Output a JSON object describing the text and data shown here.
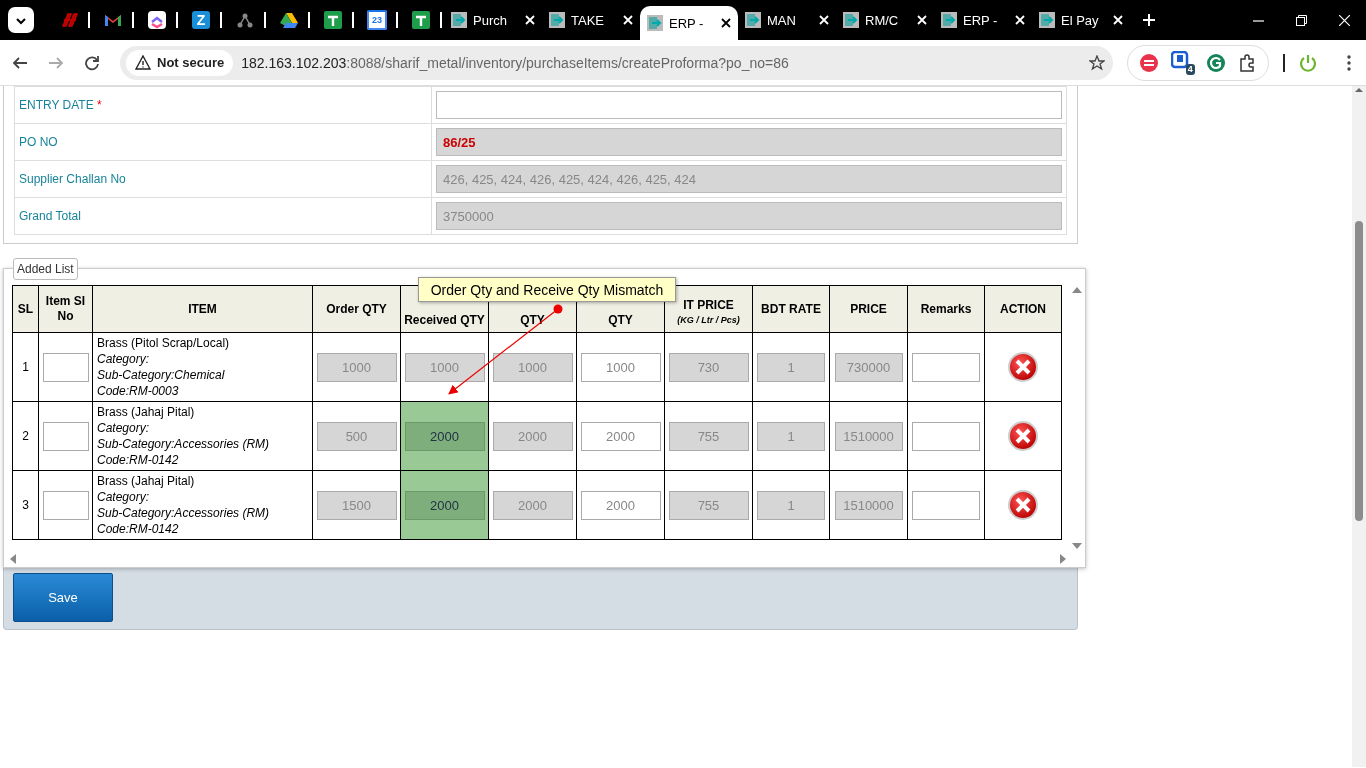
{
  "browser": {
    "pinned_tabs": [
      {
        "kind": "red-mark"
      },
      {
        "kind": "mail"
      },
      {
        "kind": "checklist"
      },
      {
        "kind": "letter",
        "label": "Z"
      },
      {
        "kind": "network"
      },
      {
        "kind": "drive"
      },
      {
        "kind": "sheet"
      },
      {
        "kind": "calendar",
        "label": "23"
      },
      {
        "kind": "sheet"
      }
    ],
    "tabs": [
      {
        "title": "Purch",
        "selected": false
      },
      {
        "title": "TAKE",
        "selected": false
      },
      {
        "title": "ERP -",
        "selected": true
      },
      {
        "title": "MAN",
        "selected": false
      },
      {
        "title": "RM/C",
        "selected": false
      },
      {
        "title": "ERP -",
        "selected": false
      },
      {
        "title": "El Pay",
        "selected": false
      }
    ],
    "security": "Not secure",
    "url_host": "182.163.102.203",
    "url_rest": ":8088/sharif_metal/inventory/purchaseItems/createProforma?po_no=86",
    "extension_badge": "4"
  },
  "form": {
    "fields": [
      {
        "label": "ENTRY DATE",
        "required_mark": "*",
        "readonly": false
      },
      {
        "label": "PO NO",
        "readonly": true,
        "value": "86/25",
        "emphasis": true
      },
      {
        "label": "Supplier Challan No",
        "readonly": true,
        "value": "426, 425, 424, 426, 425, 424, 426, 425, 424",
        "emphasis": false
      },
      {
        "label": "Grand Total",
        "readonly": true,
        "value": "3750000",
        "emphasis": false
      }
    ]
  },
  "added_list": {
    "legend": "Added List",
    "columns": [
      {
        "label": "SL",
        "kind": "sl"
      },
      {
        "label": "Item SI No",
        "kind": "input",
        "editable": true
      },
      {
        "label": "ITEM",
        "kind": "item"
      },
      {
        "label": "Order QTY",
        "kind": "input",
        "editable": false
      },
      {
        "label": "Received QTY",
        "kind": "input",
        "editable": false
      },
      {
        "label": "QTY",
        "kind": "input",
        "editable": false
      },
      {
        "label": "QTY",
        "kind": "input",
        "editable": true
      },
      {
        "label": "IT PRICE",
        "sublabel": "(KG / Ltr / Pcs)",
        "kind": "input",
        "editable": false
      },
      {
        "label": "BDT RATE",
        "kind": "input",
        "editable": false
      },
      {
        "label": "PRICE",
        "kind": "input",
        "editable": false
      },
      {
        "label": "Remarks",
        "kind": "input",
        "editable": true
      },
      {
        "label": "ACTION",
        "kind": "action"
      }
    ],
    "rows": [
      {
        "sl": "1",
        "item": "Brass (Pitol Scrap/Local)",
        "category": "Category:",
        "sub_category": "Sub-Category:Chemical",
        "code": "Code:RM-0003",
        "order_qty": "1000",
        "received_qty": "1000",
        "column_6": "1000",
        "column_7": "1000",
        "unit_price": "730",
        "bdt_rate": "1",
        "price": "730000",
        "mismatch": false
      },
      {
        "sl": "2",
        "item": "Brass (Jahaj Pital)",
        "category": "Category:",
        "sub_category": "Sub-Category:Accessories (RM)",
        "code": "Code:RM-0142",
        "order_qty": "500",
        "received_qty": "2000",
        "column_6": "2000",
        "column_7": "2000",
        "unit_price": "755",
        "bdt_rate": "1",
        "price": "1510000",
        "mismatch": true
      },
      {
        "sl": "3",
        "item": "Brass (Jahaj Pital)",
        "category": "Category:",
        "sub_category": "Sub-Category:Accessories (RM)",
        "code": "Code:RM-0142",
        "order_qty": "1500",
        "received_qty": "2000",
        "column_6": "2000",
        "column_7": "2000",
        "unit_price": "755",
        "bdt_rate": "1",
        "price": "1510000",
        "mismatch": true
      }
    ],
    "callout": "Order Qty and Receive Qty Mismatch"
  },
  "save_button": "Save"
}
